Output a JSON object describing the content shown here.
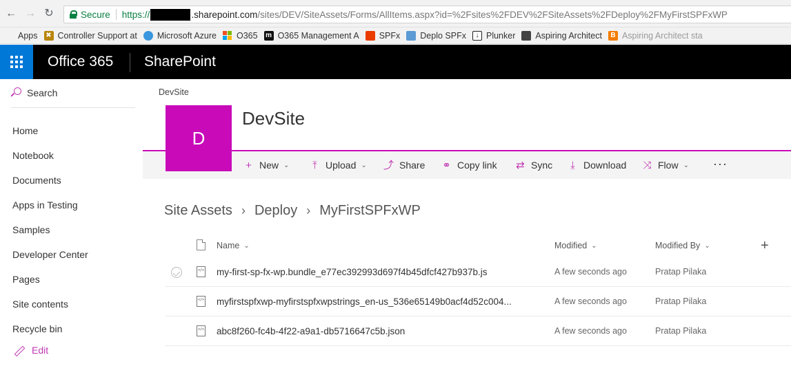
{
  "browser": {
    "secure_label": "Secure",
    "url_scheme": "https://",
    "url_host": ".sharepoint.com",
    "url_path": "/sites/DEV/SiteAssets/Forms/AllItems.aspx?id=%2Fsites%2FDEV%2FSiteAssets%2FDeploy%2FMyFirstSPFxWP",
    "bookmarks": [
      {
        "label": "Apps",
        "icon": "apps-grid-icon",
        "color": "#c53929"
      },
      {
        "label": "Controller Support at",
        "icon": "controller-support-icon",
        "color": "#b8860b"
      },
      {
        "label": "Microsoft Azure",
        "icon": "azure-cloud-icon",
        "color": "#3a96dd"
      },
      {
        "label": "O365",
        "icon": "office-logo-icon",
        "color": "#e74c1c"
      },
      {
        "label": "O365 Management A",
        "icon": "m-logo-icon",
        "color": "#111111"
      },
      {
        "label": "SPFx",
        "icon": "office-icon",
        "color": "#eb3c00"
      },
      {
        "label": "Deplo SPFx",
        "icon": "bookmark-page-icon",
        "color": "#5b9bd5"
      },
      {
        "label": "Plunker",
        "icon": "plunker-icon",
        "color": "#222222"
      },
      {
        "label": "Aspiring Architect",
        "icon": "aspiring-architect-icon",
        "color": "#444444"
      },
      {
        "label": "Aspiring Architect sta",
        "icon": "blogger-icon",
        "color": "#f57d00"
      }
    ]
  },
  "suite": {
    "brand": "Office 365",
    "app": "SharePoint",
    "accent": "#0078d7"
  },
  "leftnav": {
    "search_label": "Search",
    "items": [
      "Home",
      "Notebook",
      "Documents",
      "Apps in Testing",
      "Samples",
      "Developer Center",
      "Pages",
      "Site contents",
      "Recycle bin"
    ],
    "edit_label": "Edit"
  },
  "site": {
    "breadcrumb": "DevSite",
    "logo_letter": "D",
    "title": "DevSite",
    "theme_color": "#c80ab9"
  },
  "commands": {
    "new": "New",
    "upload": "Upload",
    "share": "Share",
    "copy_link": "Copy link",
    "sync": "Sync",
    "download": "Download",
    "flow": "Flow",
    "more": "···"
  },
  "path": [
    "Site Assets",
    "Deploy",
    "MyFirstSPFxWP"
  ],
  "list": {
    "columns": {
      "name": "Name",
      "modified": "Modified",
      "modified_by": "Modified By"
    },
    "rows": [
      {
        "name": "my-first-sp-fx-wp.bundle_e77ec392993d697f4b45dfcf427b937b.js",
        "modified": "A few seconds ago",
        "modified_by": "Pratap Pilaka"
      },
      {
        "name": "myfirstspfxwp-myfirstspfxwpstrings_en-us_536e65149b0acf4d52c004...",
        "modified": "A few seconds ago",
        "modified_by": "Pratap Pilaka"
      },
      {
        "name": "abc8f260-fc4b-4f22-a9a1-db5716647c5b.json",
        "modified": "A few seconds ago",
        "modified_by": "Pratap Pilaka"
      }
    ]
  }
}
